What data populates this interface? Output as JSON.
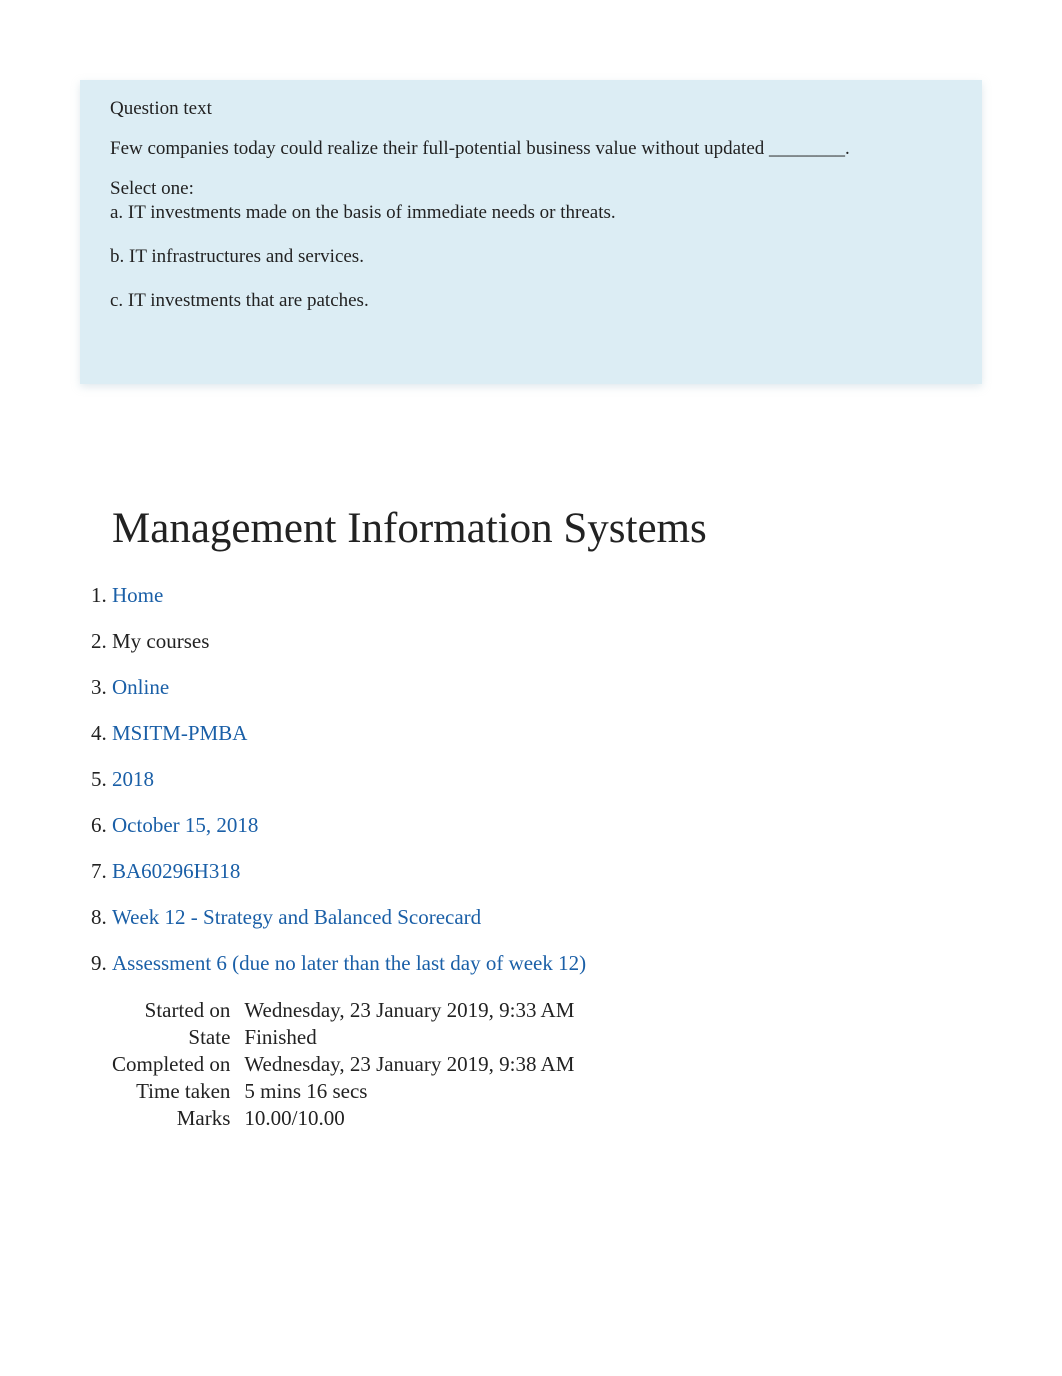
{
  "question": {
    "question_text_label": "Question text",
    "prompt": "Few companies today could realize their full-potential business value without updated ________.",
    "select_one_label": "Select one:",
    "options": {
      "a": "a. IT investments made on the basis of immediate needs or threats.",
      "b": "b. IT infrastructures and services.",
      "c": "c. IT investments that are patches."
    }
  },
  "course_title": "Management Information Systems",
  "breadcrumbs": {
    "0": {
      "label": "Home",
      "link": true
    },
    "1": {
      "label": "My courses",
      "link": false
    },
    "2": {
      "label": "Online",
      "link": true
    },
    "3": {
      "label": "MSITM-PMBA",
      "link": true
    },
    "4": {
      "label": "2018",
      "link": true
    },
    "5": {
      "label": "October 15, 2018",
      "link": true
    },
    "6": {
      "label": "BA60296H318",
      "link": true
    },
    "7": {
      "label": "Week 12 - Strategy and Balanced Scorecard",
      "link": true
    },
    "8": {
      "label": "Assessment 6 (due no later than the last day of week 12)",
      "link": true
    }
  },
  "summary": {
    "started_on_label": "Started on",
    "started_on_value": "Wednesday, 23 January 2019, 9:33 AM",
    "state_label": "State",
    "state_value": "Finished",
    "completed_on_label": "Completed on",
    "completed_on_value": "Wednesday, 23 January 2019, 9:38 AM",
    "time_taken_label": "Time taken",
    "time_taken_value": "5 mins 16 secs",
    "marks_label": "Marks",
    "marks_value": "10.00/10.00"
  }
}
